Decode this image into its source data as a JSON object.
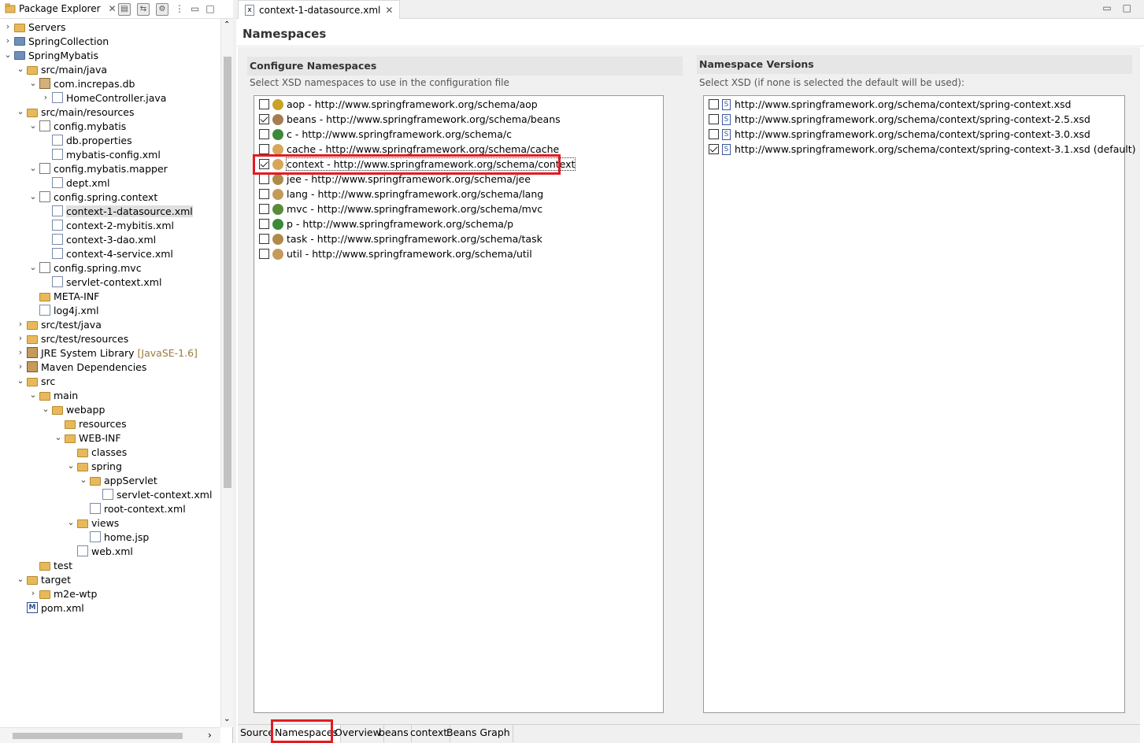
{
  "left_panel": {
    "title": "Package Explorer",
    "tree": [
      {
        "label": "Servers",
        "level": 0,
        "twisty": "›",
        "icon": "folder"
      },
      {
        "label": "SpringCollection",
        "level": 0,
        "twisty": "›",
        "icon": "project"
      },
      {
        "label": "SpringMybatis",
        "level": 0,
        "twisty": "⌄",
        "icon": "project"
      },
      {
        "label": "src/main/java",
        "level": 1,
        "twisty": "⌄",
        "icon": "folder"
      },
      {
        "label": "com.increpas.db",
        "level": 2,
        "twisty": "⌄",
        "icon": "pkg"
      },
      {
        "label": "HomeController.java",
        "level": 3,
        "twisty": "›",
        "icon": "file"
      },
      {
        "label": "src/main/resources",
        "level": 1,
        "twisty": "⌄",
        "icon": "folder"
      },
      {
        "label": "config.mybatis",
        "level": 2,
        "twisty": "⌄",
        "icon": "pkg2"
      },
      {
        "label": "db.properties",
        "level": 3,
        "twisty": "",
        "icon": "file"
      },
      {
        "label": "mybatis-config.xml",
        "level": 3,
        "twisty": "",
        "icon": "xml"
      },
      {
        "label": "config.mybatis.mapper",
        "level": 2,
        "twisty": "⌄",
        "icon": "pkg2"
      },
      {
        "label": "dept.xml",
        "level": 3,
        "twisty": "",
        "icon": "xml"
      },
      {
        "label": "config.spring.context",
        "level": 2,
        "twisty": "⌄",
        "icon": "pkg2"
      },
      {
        "label": "context-1-datasource.xml",
        "level": 3,
        "twisty": "",
        "icon": "xml",
        "selected": true
      },
      {
        "label": "context-2-mybitis.xml",
        "level": 3,
        "twisty": "",
        "icon": "xml"
      },
      {
        "label": "context-3-dao.xml",
        "level": 3,
        "twisty": "",
        "icon": "xml"
      },
      {
        "label": "context-4-service.xml",
        "level": 3,
        "twisty": "",
        "icon": "xml"
      },
      {
        "label": "config.spring.mvc",
        "level": 2,
        "twisty": "⌄",
        "icon": "pkg2"
      },
      {
        "label": "servlet-context.xml",
        "level": 3,
        "twisty": "",
        "icon": "xml"
      },
      {
        "label": "META-INF",
        "level": 2,
        "twisty": "",
        "icon": "folder"
      },
      {
        "label": "log4j.xml",
        "level": 2,
        "twisty": "",
        "icon": "xml"
      },
      {
        "label": "src/test/java",
        "level": 1,
        "twisty": "›",
        "icon": "folder"
      },
      {
        "label": "src/test/resources",
        "level": 1,
        "twisty": "›",
        "icon": "folder"
      },
      {
        "label": "JRE System Library",
        "level": 1,
        "twisty": "›",
        "icon": "lib",
        "hint": "[JavaSE-1.6]"
      },
      {
        "label": "Maven Dependencies",
        "level": 1,
        "twisty": "›",
        "icon": "lib"
      },
      {
        "label": "src",
        "level": 1,
        "twisty": "⌄",
        "icon": "folder"
      },
      {
        "label": "main",
        "level": 2,
        "twisty": "⌄",
        "icon": "folder"
      },
      {
        "label": "webapp",
        "level": 3,
        "twisty": "⌄",
        "icon": "folder"
      },
      {
        "label": "resources",
        "level": 4,
        "twisty": "",
        "icon": "folder"
      },
      {
        "label": "WEB-INF",
        "level": 4,
        "twisty": "⌄",
        "icon": "folder"
      },
      {
        "label": "classes",
        "level": 5,
        "twisty": "",
        "icon": "folder"
      },
      {
        "label": "spring",
        "level": 5,
        "twisty": "⌄",
        "icon": "folder"
      },
      {
        "label": "appServlet",
        "level": 6,
        "twisty": "⌄",
        "icon": "folder"
      },
      {
        "label": "servlet-context.xml",
        "level": 7,
        "twisty": "",
        "icon": "xml"
      },
      {
        "label": "root-context.xml",
        "level": 6,
        "twisty": "",
        "icon": "xml"
      },
      {
        "label": "views",
        "level": 5,
        "twisty": "⌄",
        "icon": "folder"
      },
      {
        "label": "home.jsp",
        "level": 6,
        "twisty": "",
        "icon": "file"
      },
      {
        "label": "web.xml",
        "level": 5,
        "twisty": "",
        "icon": "xml"
      },
      {
        "label": "test",
        "level": 2,
        "twisty": "",
        "icon": "folder"
      },
      {
        "label": "target",
        "level": 1,
        "twisty": "⌄",
        "icon": "folder"
      },
      {
        "label": "m2e-wtp",
        "level": 2,
        "twisty": "›",
        "icon": "folder"
      },
      {
        "label": "pom.xml",
        "level": 1,
        "twisty": "",
        "icon": "maven"
      }
    ]
  },
  "editor": {
    "tab_label": "context-1-datasource.xml",
    "page_title": "Namespaces",
    "configure": {
      "heading": "Configure Namespaces",
      "description": "Select XSD namespaces to use in the configuration file",
      "items": [
        {
          "text": "aop - http://www.springframework.org/schema/aop",
          "checked": false,
          "color": "#c9a227"
        },
        {
          "text": "beans - http://www.springframework.org/schema/beans",
          "checked": true,
          "color": "#a67c52"
        },
        {
          "text": "c - http://www.springframework.org/schema/c",
          "checked": false,
          "color": "#3b8a3b"
        },
        {
          "text": "cache - http://www.springframework.org/schema/cache",
          "checked": false,
          "color": "#d6a65a"
        },
        {
          "text": "context - http://www.springframework.org/schema/context",
          "checked": true,
          "color": "#d6a65a",
          "focused": true
        },
        {
          "text": "jee - http://www.springframework.org/schema/jee",
          "checked": false,
          "color": "#b08a4a"
        },
        {
          "text": "lang - http://www.springframework.org/schema/lang",
          "checked": false,
          "color": "#c49a5a"
        },
        {
          "text": "mvc - http://www.springframework.org/schema/mvc",
          "checked": false,
          "color": "#5a8a3a"
        },
        {
          "text": "p - http://www.springframework.org/schema/p",
          "checked": false,
          "color": "#3b8a3b"
        },
        {
          "text": "task - http://www.springframework.org/schema/task",
          "checked": false,
          "color": "#b08a4a"
        },
        {
          "text": "util - http://www.springframework.org/schema/util",
          "checked": false,
          "color": "#c49a5a"
        }
      ]
    },
    "versions": {
      "heading": "Namespace Versions",
      "description": "Select XSD (if none is selected the default will be used):",
      "items": [
        {
          "text": "http://www.springframework.org/schema/context/spring-context.xsd",
          "checked": false
        },
        {
          "text": "http://www.springframework.org/schema/context/spring-context-2.5.xsd",
          "checked": false
        },
        {
          "text": "http://www.springframework.org/schema/context/spring-context-3.0.xsd",
          "checked": false
        },
        {
          "text": "http://www.springframework.org/schema/context/spring-context-3.1.xsd (default)",
          "checked": true
        }
      ]
    },
    "bottom_tabs": [
      "Source",
      "Namespaces",
      "Overview",
      "beans",
      "context",
      "Beans Graph"
    ],
    "active_bottom_tab": "Namespaces"
  },
  "colors": {
    "highlight": "#e21b23",
    "section_header_bg": "#e6e6e6"
  }
}
